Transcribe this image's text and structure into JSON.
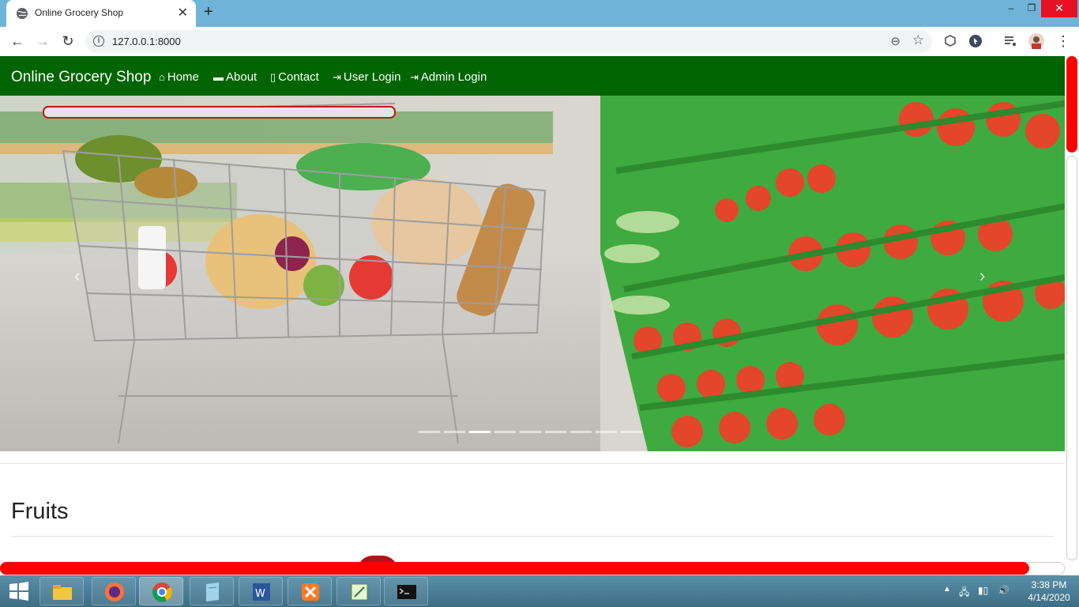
{
  "browser": {
    "tab_title": "Online Grocery Shop",
    "tab_close": "✕",
    "new_tab": "+",
    "url": "127.0.0.1:8000",
    "window_controls": {
      "minimize": "–",
      "maximize": "❐",
      "close": "✕"
    }
  },
  "site": {
    "brand": "Online Grocery Shop",
    "nav": [
      {
        "label": "Home",
        "icon": "home-icon"
      },
      {
        "label": "About",
        "icon": "card-icon"
      },
      {
        "label": "Contact",
        "icon": "phone-icon"
      },
      {
        "label": "User Login",
        "icon": "login-icon"
      },
      {
        "label": "Admin Login",
        "icon": "login-icon"
      }
    ],
    "carousel": {
      "slides": 9,
      "active_index": 2
    },
    "section_title": "Fruits"
  },
  "taskbar": {
    "time": "3:38 PM",
    "date": "4/14/2020",
    "apps": [
      "file-explorer",
      "firefox",
      "chrome",
      "notepad",
      "word",
      "xampp",
      "editor",
      "command-prompt"
    ]
  },
  "colors": {
    "nav_bg": "#006400",
    "scrollbar": "#ff0000",
    "close_button": "#e81123"
  }
}
